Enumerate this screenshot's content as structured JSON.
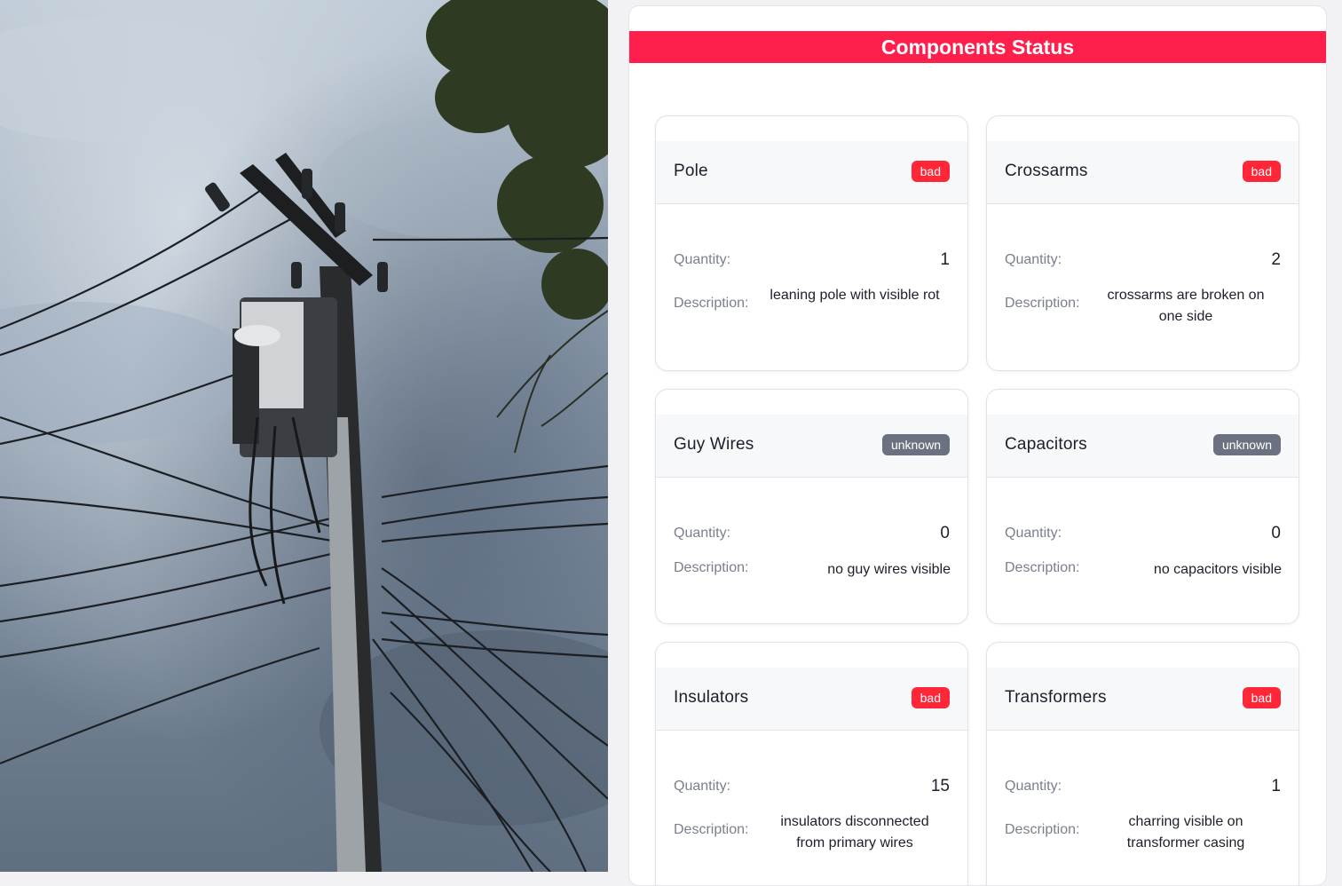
{
  "panel": {
    "title": "Components Status"
  },
  "components": [
    {
      "name": "Pole",
      "status": "bad",
      "quantity_label": "Quantity:",
      "quantity": "1",
      "description_label": "Description:",
      "description": "leaning pole with visible rot"
    },
    {
      "name": "Crossarms",
      "status": "bad",
      "quantity_label": "Quantity:",
      "quantity": "2",
      "description_label": "Description:",
      "description": "crossarms are broken on one side"
    },
    {
      "name": "Guy Wires",
      "status": "unknown",
      "quantity_label": "Quantity:",
      "quantity": "0",
      "description_label": "Description:",
      "description": "no guy wires visible"
    },
    {
      "name": "Capacitors",
      "status": "unknown",
      "quantity_label": "Quantity:",
      "quantity": "0",
      "description_label": "Description:",
      "description": "no capacitors visible"
    },
    {
      "name": "Insulators",
      "status": "bad",
      "quantity_label": "Quantity:",
      "quantity": "15",
      "description_label": "Description:",
      "description": "insulators disconnected from primary wires"
    },
    {
      "name": "Transformers",
      "status": "bad",
      "quantity_label": "Quantity:",
      "quantity": "1",
      "description_label": "Description:",
      "description": "charring visible on transformer casing"
    }
  ],
  "colors": {
    "header": "#ff1f4d",
    "bad_badge": "#ff2638",
    "unknown_badge": "#6b7180"
  }
}
